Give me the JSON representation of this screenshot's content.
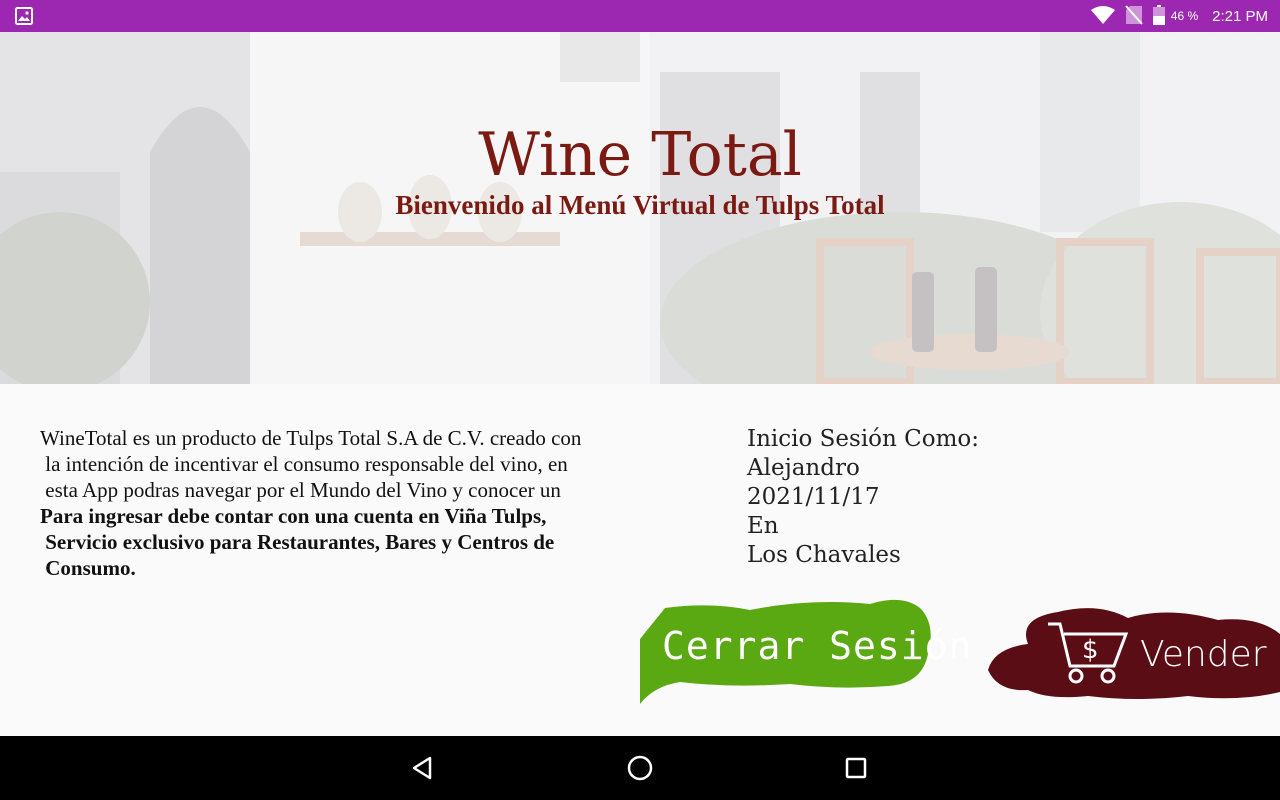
{
  "status_bar": {
    "battery_percent": "46 %",
    "time": "2:21 PM",
    "icons": [
      "image-icon",
      "wifi-icon",
      "no-sim-icon",
      "battery-icon"
    ]
  },
  "header": {
    "title": "Wine Total",
    "subtitle": "Bienvenido al Menú Virtual de Tulps Total"
  },
  "description": {
    "lines": [
      "WineTotal es un producto de Tulps Total S.A de C.V. creado con",
      " la intención de incentivar el consumo responsable del vino, en",
      " esta App podras navegar por el Mundo del Vino y conocer un"
    ],
    "bold_lines": [
      "Para ingresar debe contar con una cuenta en Viña Tulps,",
      " Servicio exclusivo para Restaurantes, Bares y Centros de",
      " Consumo."
    ]
  },
  "session": {
    "label": "Inicio Sesión Como:",
    "user": "Alejandro",
    "date": "2021/11/17",
    "preposition": "En",
    "place": "Los Chavales"
  },
  "buttons": {
    "logout_label": "Cerrar Sesión",
    "sell_label": "Vender",
    "logout_color": "#5aa812",
    "sell_color": "#5a0d14"
  },
  "nav_bar": {
    "icons": [
      "back-icon",
      "home-icon",
      "recents-icon"
    ]
  }
}
